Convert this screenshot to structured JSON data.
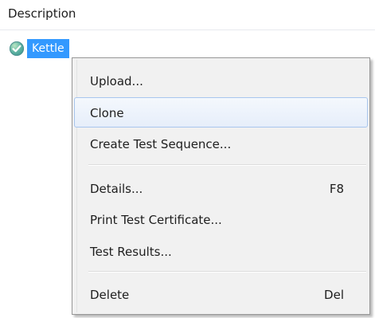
{
  "header": {
    "title": "Description"
  },
  "tree": {
    "node_label": "Kettle",
    "status_icon": "check-circle-icon"
  },
  "context_menu": {
    "items": [
      {
        "label": "Upload...",
        "shortcut": ""
      },
      {
        "label": "Clone",
        "shortcut": ""
      },
      {
        "label": "Create Test Sequence...",
        "shortcut": ""
      },
      {
        "label": "Details...",
        "shortcut": "F8"
      },
      {
        "label": "Print Test Certificate...",
        "shortcut": ""
      },
      {
        "label": "Test Results...",
        "shortcut": ""
      },
      {
        "label": "Delete",
        "shortcut": "Del"
      }
    ],
    "highlighted_item": "Clone"
  },
  "colors": {
    "selection": "#3399ff",
    "menu_background": "#f1f1f1",
    "hover_border": "#a8c6ee"
  }
}
